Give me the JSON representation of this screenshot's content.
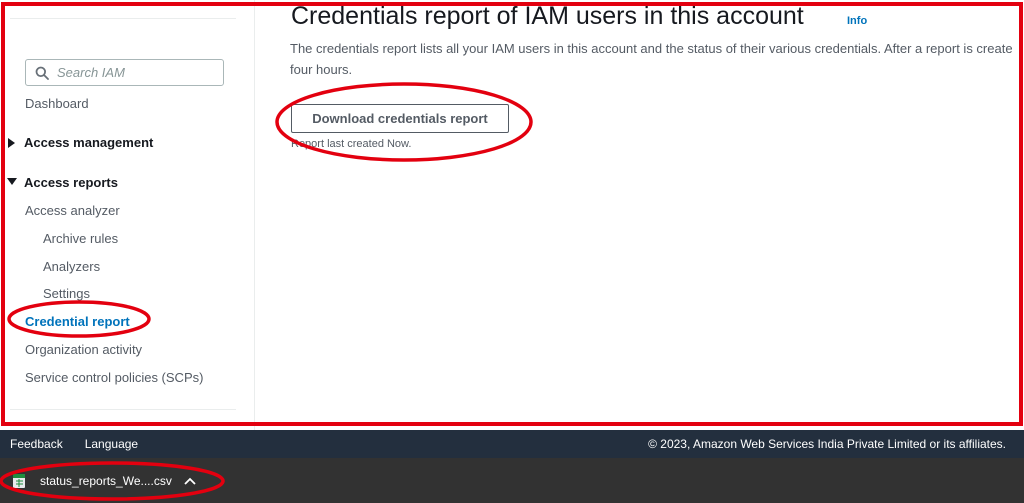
{
  "sidebar": {
    "search_placeholder": "Search IAM",
    "dashboard": "Dashboard",
    "access_management": "Access management",
    "access_reports": "Access reports",
    "access_analyzer": "Access analyzer",
    "archive_rules": "Archive rules",
    "analyzers": "Analyzers",
    "settings": "Settings",
    "credential_report": "Credential report",
    "organization_activity": "Organization activity",
    "scps": "Service control policies (SCPs)"
  },
  "main": {
    "title": "Credentials report of IAM users in this account",
    "info": "Info",
    "description_line1": "The credentials report lists all your IAM users in this account and the status of their various credentials. After a report is create",
    "description_line2": "four hours.",
    "download_button": "Download credentials report",
    "last_created": "Report last created Now."
  },
  "footer": {
    "feedback": "Feedback",
    "language": "Language",
    "copyright": "© 2023, Amazon Web Services India Private Limited or its affiliates."
  },
  "download_bar": {
    "filename": "status_reports_We....csv"
  },
  "colors": {
    "link_active": "#0073bb",
    "footer_bg": "#232f3e",
    "download_bar_bg": "#323232",
    "annotation": "#e3000f"
  },
  "icons": {
    "search": "search-icon",
    "file": "csv-file-icon",
    "chevron": "chevron-up-icon"
  }
}
